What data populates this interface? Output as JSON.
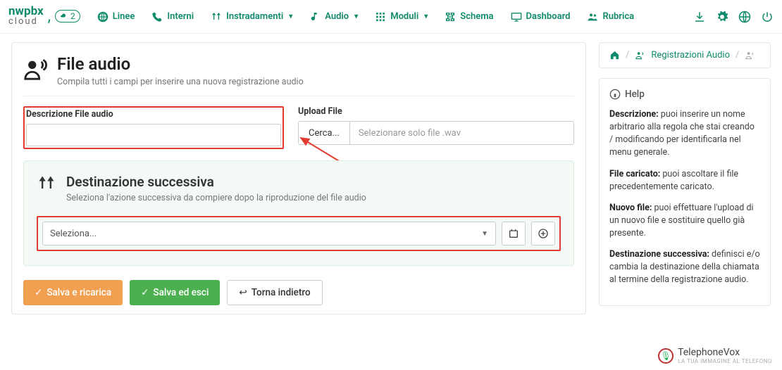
{
  "logo": {
    "line1": "nwpbx",
    "line2": "cloud",
    "badge": "2"
  },
  "nav": {
    "linee": "Linee",
    "interni": "Interni",
    "instradamenti": "Instradamenti",
    "audio": "Audio",
    "moduli": "Moduli",
    "schema": "Schema",
    "dashboard": "Dashboard",
    "rubrica": "Rubrica"
  },
  "page": {
    "title": "File audio",
    "subtitle": "Compila tutti i campi per inserire una nuova registrazione audio"
  },
  "form": {
    "desc_label": "Descrizione File audio",
    "desc_value": "",
    "upload_label": "Upload File",
    "upload_button": "Cerca...",
    "upload_placeholder": "Selezionare solo file .wav"
  },
  "dest": {
    "title": "Destinazione successiva",
    "subtitle": "Seleziona l'azione successiva da compiere dopo la riproduzione del file audio",
    "select_placeholder": "Seleziona..."
  },
  "actions": {
    "save_reload": "Salva e ricarica",
    "save_exit": "Salva ed esci",
    "back": "Torna indietro"
  },
  "breadcrumb": {
    "link": "Registrazioni Audio"
  },
  "help": {
    "title": "Help",
    "p1b": "Descrizione:",
    "p1": " puoi inserire un nome arbitrario alla regola che stai creando / modificando per identificarla nel menu generale.",
    "p2b": "File caricato:",
    "p2": " puoi ascoltare il file precedentemente caricato.",
    "p3b": "Nuovo file:",
    "p3": " puoi effettuare l'upload di un nuovo file e sostituire quello già presente.",
    "p4b": "Destinazione successiva:",
    "p4": " definisci e/o cambia la destinazione della chiamata al termine della registrazione audio."
  },
  "footer_logo": {
    "name": "TelephoneVox",
    "tag": "LA TUA IMMAGINE AL TELEFONO"
  }
}
